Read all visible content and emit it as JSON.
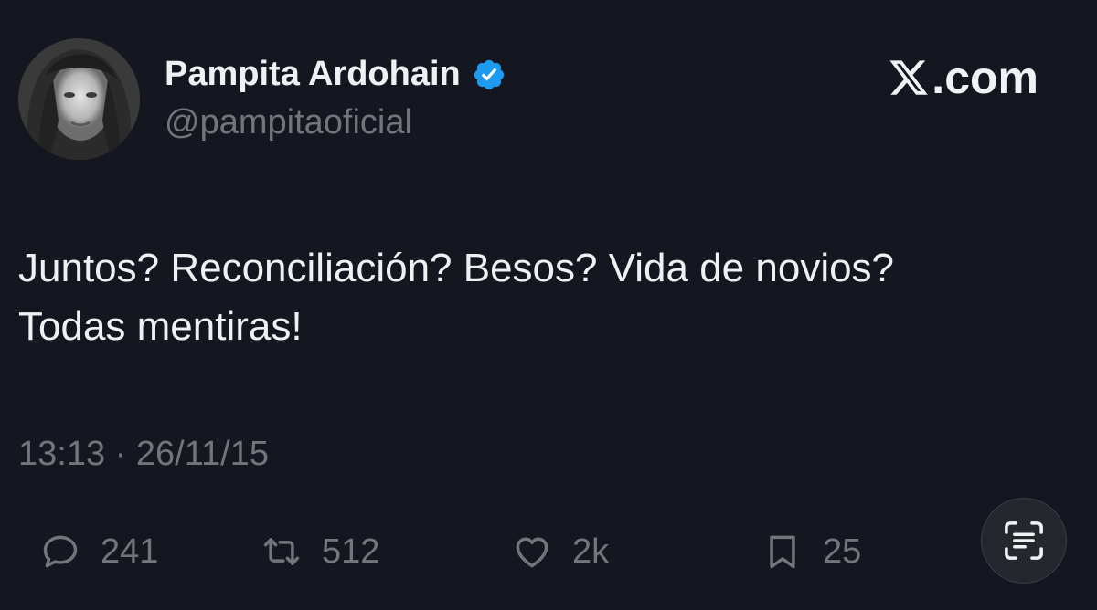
{
  "author": {
    "display_name": "Pampita Ardohain",
    "handle": "@pampitaoficial",
    "verified": true,
    "avatar": "profile-photo"
  },
  "brand": {
    "label": ".com",
    "icon": "x-logo-icon"
  },
  "tweet": {
    "lines": [
      "Juntos? Reconciliación? Besos? Vida de novios?",
      "Todas mentiras!"
    ],
    "timestamp": "13:13 · 26/11/15"
  },
  "actions": {
    "replies": {
      "icon": "reply-icon",
      "count": "241"
    },
    "retweets": {
      "icon": "retweet-icon",
      "count": "512"
    },
    "likes": {
      "icon": "heart-icon",
      "count": "2k"
    },
    "bookmarks": {
      "icon": "bookmark-icon",
      "count": "25"
    }
  },
  "overlay": {
    "icon": "text-scan-icon"
  },
  "colors": {
    "background": "#14171f",
    "text_primary": "#eef0f2",
    "text_secondary": "#71767b",
    "verified_badge": "#1d9bf0"
  }
}
